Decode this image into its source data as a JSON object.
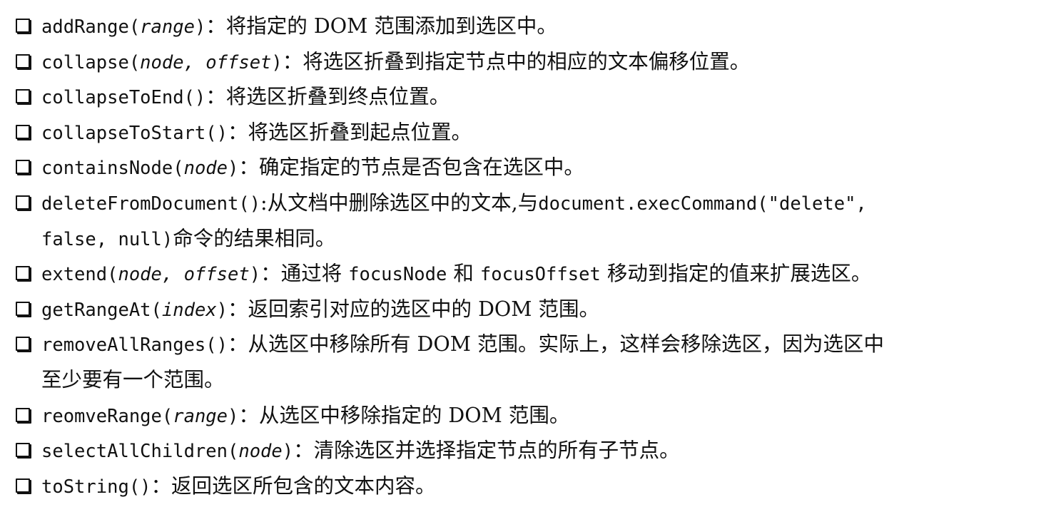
{
  "items": [
    {
      "method": "addRange(",
      "arg": "range",
      "close": ")",
      "desc": "：将指定的 DOM 范围添加到选区中。"
    },
    {
      "method": "collapse(",
      "arg": "node, offset",
      "close": ")",
      "desc": "：将选区折叠到指定节点中的相应的文本偏移位置。"
    },
    {
      "method": "collapseToEnd()",
      "arg": "",
      "close": "",
      "desc": "：将选区折叠到终点位置。"
    },
    {
      "method": "collapseToStart()",
      "arg": "",
      "close": "",
      "desc": "：将选区折叠到起点位置。"
    },
    {
      "method": "containsNode(",
      "arg": "node",
      "close": ")",
      "desc": "：确定指定的节点是否包含在选区中。"
    },
    {
      "method": "deleteFromDocument()",
      "arg": "",
      "close": "",
      "desc": ":从文档中删除选区中的文本,与",
      "code2": "document.execCommand(\"delete\",",
      "cont_code": "false, null)",
      "cont_desc": "命令的结果相同。"
    },
    {
      "method": "extend(",
      "arg": "node, offset",
      "close": ")",
      "desc": "：通过将 ",
      "code2": "focusNode",
      "mid": " 和 ",
      "code3": "focusOffset",
      "tail": " 移动到指定的值来扩展选区。"
    },
    {
      "method": "getRangeAt(",
      "arg": "index",
      "close": ")",
      "desc": "：返回索引对应的选区中的 DOM 范围。"
    },
    {
      "method": "removeAllRanges()",
      "arg": "",
      "close": "",
      "desc": "：从选区中移除所有 DOM 范围。实际上，这样会移除选区，因为选区中",
      "cont_desc": "至少要有一个范围。"
    },
    {
      "method": "reomveRange(",
      "arg": "range",
      "close": ")",
      "desc": "：从选区中移除指定的 DOM 范围。"
    },
    {
      "method": "selectAllChildren(",
      "arg": "node",
      "close": ")",
      "desc": "：清除选区并选择指定节点的所有子节点。"
    },
    {
      "method": "toString()",
      "arg": "",
      "close": "",
      "desc": "：返回选区所包含的文本内容。"
    }
  ]
}
